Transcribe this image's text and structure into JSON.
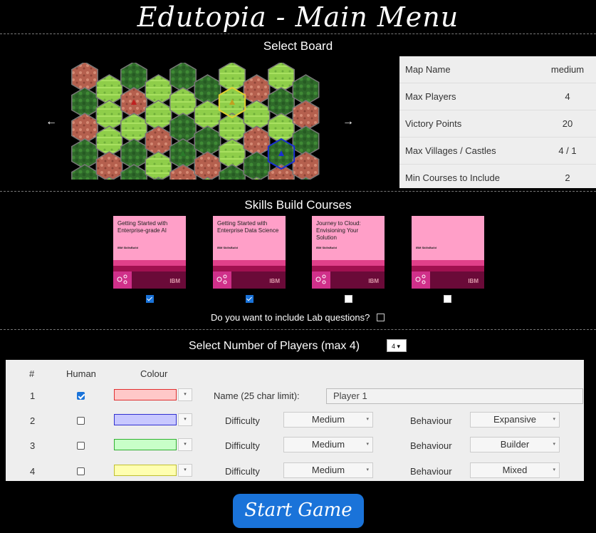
{
  "title": "Edutopia - Main Menu",
  "select_board": {
    "heading": "Select Board",
    "prev_arrow": "←",
    "next_arrow": "→"
  },
  "board_info": [
    {
      "label": "Map Name",
      "value": "medium"
    },
    {
      "label": "Max Players",
      "value": "4"
    },
    {
      "label": "Victory Points",
      "value": "20"
    },
    {
      "label": "Max Villages / Castles",
      "value": "4 / 1"
    },
    {
      "label": "Min Courses to Include",
      "value": "2"
    }
  ],
  "courses": {
    "heading": "Skills Build Courses",
    "brand": "IBM SkillsBuild",
    "logo": "IBM",
    "items": [
      {
        "title": "Getting Started with Enterprise-grade AI",
        "checked": true,
        "icon": "network-icon"
      },
      {
        "title": "Getting Started with Enterprise Data Science",
        "checked": true,
        "icon": "chart-icon"
      },
      {
        "title": "Journey to Cloud: Envisioning Your Solution",
        "checked": false,
        "icon": "cloud-icon"
      },
      {
        "title": "",
        "checked": false,
        "icon": "cloud-icon"
      }
    ],
    "lab_question": "Do you want to include Lab questions?"
  },
  "players": {
    "heading": "Select Number of Players (max 4)",
    "count_value": "4",
    "col_num": "#",
    "col_human": "Human",
    "col_colour": "Colour",
    "name_label": "Name (25 char limit):",
    "name_value": "Player 1",
    "difficulty_label": "Difficulty",
    "behaviour_label": "Behaviour",
    "rows": [
      {
        "num": "1",
        "human": true,
        "colour": "#ffc8c8",
        "border": "#e03030"
      },
      {
        "num": "2",
        "human": false,
        "colour": "#c8c8ff",
        "border": "#3030d0",
        "difficulty": "Medium",
        "behaviour": "Expansive"
      },
      {
        "num": "3",
        "human": false,
        "colour": "#c8ffc8",
        "border": "#30b030",
        "difficulty": "Medium",
        "behaviour": "Builder"
      },
      {
        "num": "4",
        "human": false,
        "colour": "#ffffb0",
        "border": "#c0c030",
        "difficulty": "Medium",
        "behaviour": "Mixed"
      }
    ]
  },
  "start_button": "Start Game"
}
